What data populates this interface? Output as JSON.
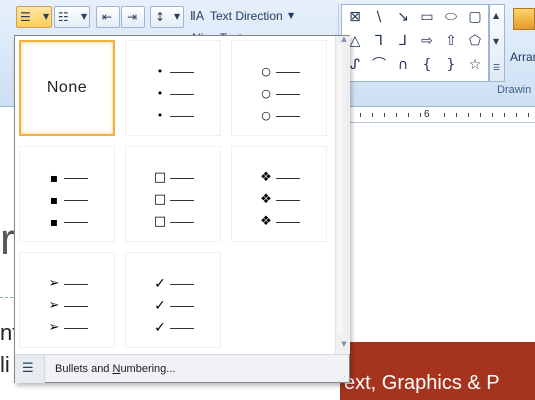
{
  "ribbon": {
    "bullets_icon": "bulleted-list-icon",
    "numbering_icon": "numbered-list-icon",
    "decrease_indent_icon": "decrease-indent-icon",
    "increase_indent_icon": "increase-indent-icon",
    "line_spacing_icon": "line-spacing-icon",
    "text_direction_label": "Text Direction",
    "align_text_partial": "Align Text",
    "arrange_label": "Arran",
    "drawing_label": "Drawin"
  },
  "ruler": {
    "number": "6"
  },
  "document": {
    "partial_left_1": "r",
    "partial_left_2": "nta",
    "partial_left_3": "li",
    "banner_text": "ext, Graphics & P"
  },
  "bullet_gallery": {
    "cells": [
      {
        "kind": "none",
        "label": "None",
        "selected": true
      },
      {
        "kind": "bullets",
        "symbol": "•",
        "icon": "small-dot-bullet-icon"
      },
      {
        "kind": "bullets",
        "symbol": "○",
        "icon": "hollow-circle-bullet-icon"
      },
      {
        "kind": "bullets",
        "symbol": "▪",
        "icon": "filled-square-bullet-icon"
      },
      {
        "kind": "bullets",
        "symbol": "□",
        "icon": "hollow-square-bullet-icon"
      },
      {
        "kind": "bullets",
        "symbol": "❖",
        "icon": "diamond-cluster-bullet-icon"
      },
      {
        "kind": "bullets",
        "symbol": "➢",
        "icon": "arrow-bullet-icon"
      },
      {
        "kind": "bullets",
        "symbol": "✓",
        "icon": "checkmark-bullet-icon"
      }
    ],
    "footer": {
      "icon": "bulleted-list-icon",
      "label_before": "Bullets and ",
      "label_underlined": "N",
      "label_after": "umbering..."
    }
  },
  "colors": {
    "selection_border": "#f2b13a",
    "ribbon_bg": "#dce8f6",
    "banner": "#a5341e"
  }
}
